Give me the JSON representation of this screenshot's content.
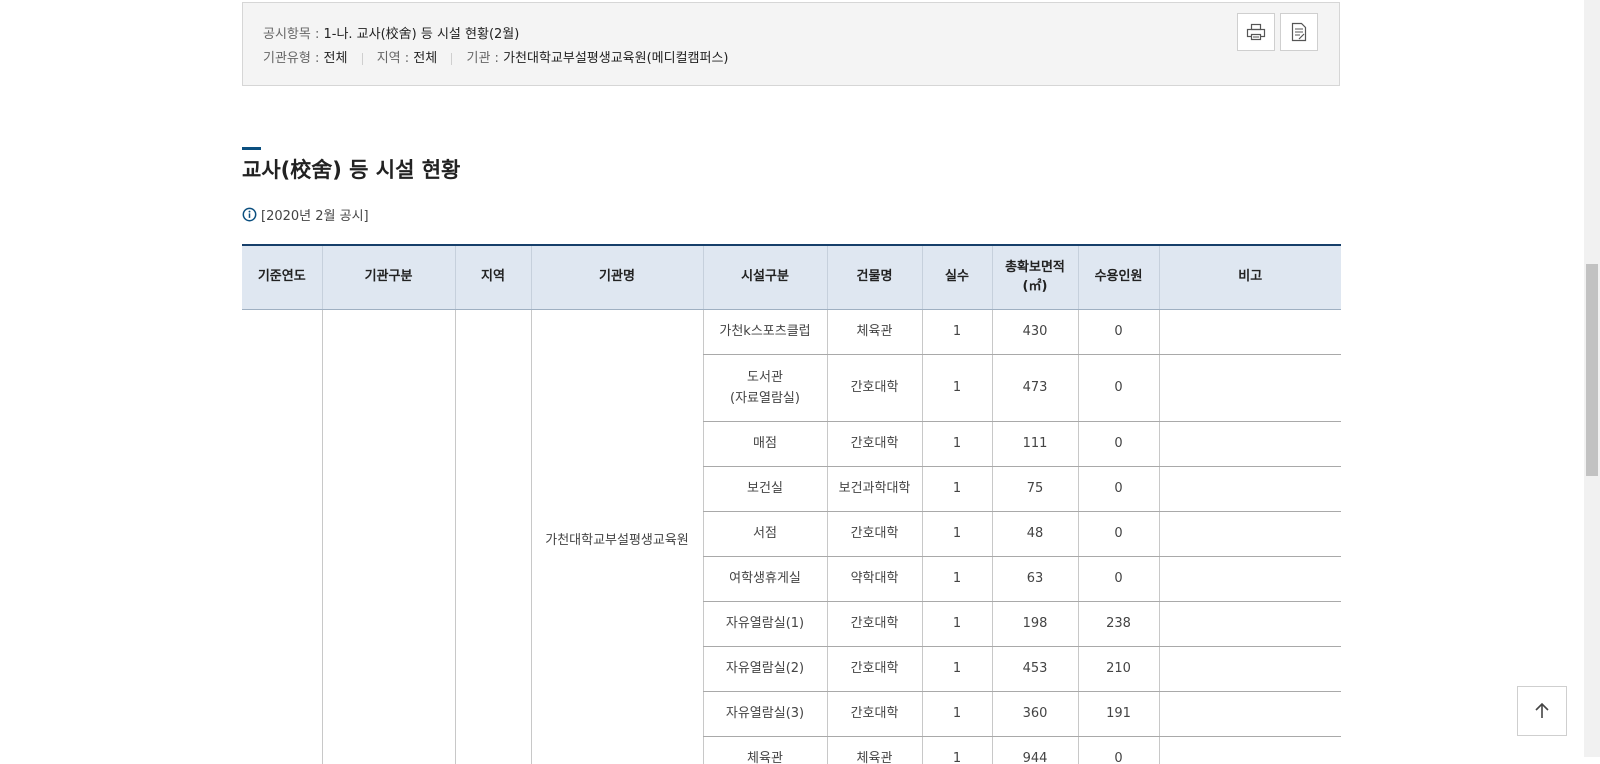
{
  "info": {
    "item_label": "공시항목 :",
    "item_value": "1-나. 교사(校舍) 등 시설 현황(2월)",
    "type_label": "기관유형 :",
    "type_value": "전체",
    "region_label": "지역 :",
    "region_value": "전체",
    "org_label": "기관 :",
    "org_value": "가천대학교부설평생교육원(메디컬캠퍼스)"
  },
  "icons": {
    "print": "print-icon",
    "document": "document-icon",
    "info": "info-icon",
    "arrow_up": "arrow-up-icon"
  },
  "section": {
    "title": "교사(校舍) 등 시설 현황",
    "notice": "[2020년 2월 공시]"
  },
  "table": {
    "headers": [
      "기준연도",
      "기관구분",
      "지역",
      "기관명",
      "시설구분",
      "건물명",
      "실수",
      "총확보면적\n(㎡)",
      "수용인원",
      "비고"
    ],
    "institution_name": "가천대학교부설평생교육원",
    "rows": [
      {
        "facility": "가천k스포츠클럽",
        "building": "체육관",
        "rooms": "1",
        "area": "430",
        "capacity": "0",
        "note": ""
      },
      {
        "facility": "도서관\n(자료열람실)",
        "building": "간호대학",
        "rooms": "1",
        "area": "473",
        "capacity": "0",
        "note": ""
      },
      {
        "facility": "매점",
        "building": "간호대학",
        "rooms": "1",
        "area": "111",
        "capacity": "0",
        "note": ""
      },
      {
        "facility": "보건실",
        "building": "보건과학대학",
        "rooms": "1",
        "area": "75",
        "capacity": "0",
        "note": ""
      },
      {
        "facility": "서점",
        "building": "간호대학",
        "rooms": "1",
        "area": "48",
        "capacity": "0",
        "note": ""
      },
      {
        "facility": "여학생휴게실",
        "building": "약학대학",
        "rooms": "1",
        "area": "63",
        "capacity": "0",
        "note": ""
      },
      {
        "facility": "자유열람실(1)",
        "building": "간호대학",
        "rooms": "1",
        "area": "198",
        "capacity": "238",
        "note": ""
      },
      {
        "facility": "자유열람실(2)",
        "building": "간호대학",
        "rooms": "1",
        "area": "453",
        "capacity": "210",
        "note": ""
      },
      {
        "facility": "자유열람실(3)",
        "building": "간호대학",
        "rooms": "1",
        "area": "360",
        "capacity": "191",
        "note": ""
      },
      {
        "facility": "체육관",
        "building": "체육관",
        "rooms": "1",
        "area": "944",
        "capacity": "0",
        "note": ""
      }
    ]
  },
  "colors": {
    "header_bg": "#dfe7f1",
    "header_top_border": "#163f6a",
    "accent": "#0b4f7f",
    "info_bg": "#f4f4f4"
  }
}
